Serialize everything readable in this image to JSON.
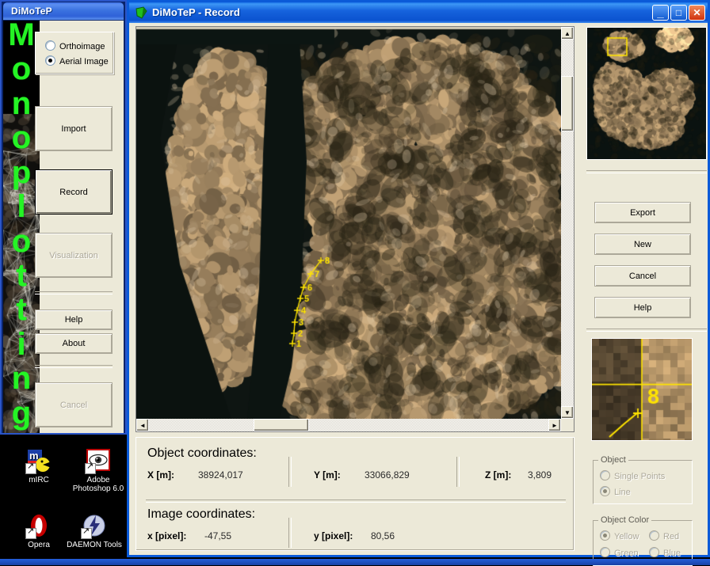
{
  "launcher": {
    "title": "DiMoTeP",
    "vertical_text": "Monoplotting",
    "image_mode": {
      "options": [
        "Orthoimage",
        "Aerial Image"
      ],
      "selected": "Aerial Image"
    },
    "buttons": [
      {
        "label": "Import",
        "enabled": true
      },
      {
        "label": "Record",
        "enabled": true,
        "default": true
      },
      {
        "label": "Visualization",
        "enabled": false
      },
      {
        "label": "Help",
        "enabled": true
      },
      {
        "label": "About",
        "enabled": true
      },
      {
        "label": "Cancel",
        "enabled": false
      }
    ]
  },
  "desktop_icons": [
    {
      "label": "mIRC",
      "icon": "mirc-icon"
    },
    {
      "label": "Adobe Photoshop 6.0",
      "icon": "photoshop-icon"
    },
    {
      "label": "Opera",
      "icon": "opera-icon"
    },
    {
      "label": "DAEMON Tools",
      "icon": "daemon-tools-icon"
    }
  ],
  "window": {
    "title": "DiMoTeP - Record",
    "minimize": "_",
    "maximize": "□",
    "close": "✕"
  },
  "coordinates": {
    "object_heading": "Object coordinates:",
    "object_fields": [
      {
        "label": "X [m]:",
        "value": "38924,017"
      },
      {
        "label": "Y [m]:",
        "value": "33066,829"
      },
      {
        "label": "Z [m]:",
        "value": "3,809"
      }
    ],
    "image_heading": "Image coordinates:",
    "image_fields": [
      {
        "label": "x [pixel]:",
        "value": "-47,55"
      },
      {
        "label": "y [pixel]:",
        "value": "80,56"
      }
    ]
  },
  "actions": [
    {
      "label": "Export"
    },
    {
      "label": "New"
    },
    {
      "label": "Cancel"
    },
    {
      "label": "Help"
    }
  ],
  "object_group": {
    "legend": "Object",
    "options": [
      "Single Points",
      "Line"
    ],
    "selected": "Line",
    "enabled": false
  },
  "object_color_group": {
    "legend": "Object Color",
    "options": [
      "Yellow",
      "Red",
      "Green",
      "Blue"
    ],
    "selected": "Yellow",
    "enabled": false
  },
  "measurement": {
    "point_labels": [
      "1",
      "2",
      "3",
      "4",
      "5",
      "6",
      "7",
      "8"
    ],
    "marker_color": "#ffe400",
    "overview_roi_color": "#ffe400"
  },
  "scrollbars": {
    "vertical": {
      "up": "▲",
      "down": "▼",
      "thumb_position_pct": 13
    },
    "horizontal": {
      "left": "◄",
      "right": "►",
      "thumb_position_pct": 28
    }
  }
}
